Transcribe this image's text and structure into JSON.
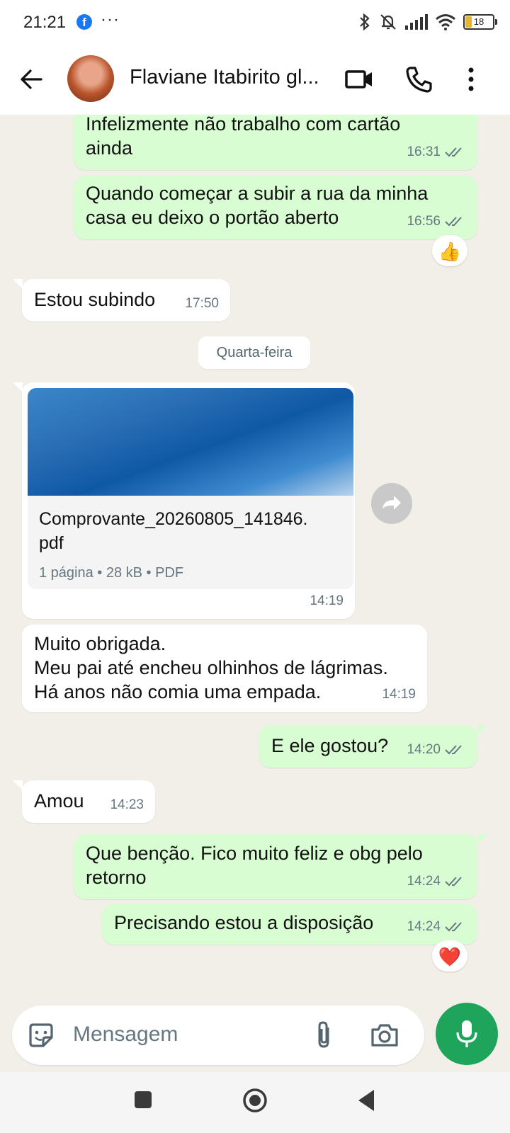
{
  "status_bar": {
    "time": "21:21",
    "dots": "···",
    "battery": "18"
  },
  "header": {
    "contact_name": "Flaviane Itabirito gl..."
  },
  "messages": [
    {
      "type": "out",
      "text_lines": [
        "Infelizmente não trabalho com cartão",
        "ainda"
      ],
      "time": "16:31"
    },
    {
      "type": "out",
      "text_lines": [
        "Quando começar a subir a rua da minha",
        "casa eu deixo o portão aberto"
      ],
      "time": "16:56",
      "reaction": "👍"
    },
    {
      "type": "in",
      "text_lines": [
        "Estou subindo"
      ],
      "time": "17:50"
    },
    {
      "type": "date",
      "text": "Quarta-feira"
    },
    {
      "type": "in-doc",
      "file_name_lines": [
        "Comprovante_20260805_141846.",
        "pdf"
      ],
      "meta": "1 página • 28 kB • PDF",
      "time": "14:19"
    },
    {
      "type": "in",
      "text_lines": [
        "Muito obrigada.",
        "Meu pai até encheu olhinhos de lágrimas.",
        "Há anos não comia uma empada."
      ],
      "time": "14:19"
    },
    {
      "type": "out",
      "text_lines": [
        "E ele gostou?"
      ],
      "time": "14:20"
    },
    {
      "type": "in",
      "text_lines": [
        "Amou"
      ],
      "time": "14:23"
    },
    {
      "type": "out",
      "text_lines": [
        "Que benção. Fico muito feliz e obg pelo",
        "retorno"
      ],
      "time": "14:24"
    },
    {
      "type": "out",
      "text_lines": [
        "Precisando estou a disposição"
      ],
      "time": "14:24",
      "reaction": "❤️"
    }
  ],
  "composer": {
    "placeholder": "Mensagem"
  },
  "colors": {
    "outgoing_bubble": "#d9fdd3",
    "incoming_bubble": "#ffffff",
    "chat_background": "#f2efe9",
    "accent_green": "#1fa55b",
    "read_ticks": "#667781"
  },
  "icons": [
    "facebook-icon",
    "bluetooth-icon",
    "mute-icon",
    "signal-icon",
    "wifi-icon",
    "battery-icon",
    "back-arrow-icon",
    "video-call-icon",
    "phone-icon",
    "more-options-icon",
    "forward-icon",
    "sticker-icon",
    "attach-icon",
    "camera-icon",
    "mic-icon",
    "nav-recents-icon",
    "nav-home-icon",
    "nav-back-icon"
  ]
}
